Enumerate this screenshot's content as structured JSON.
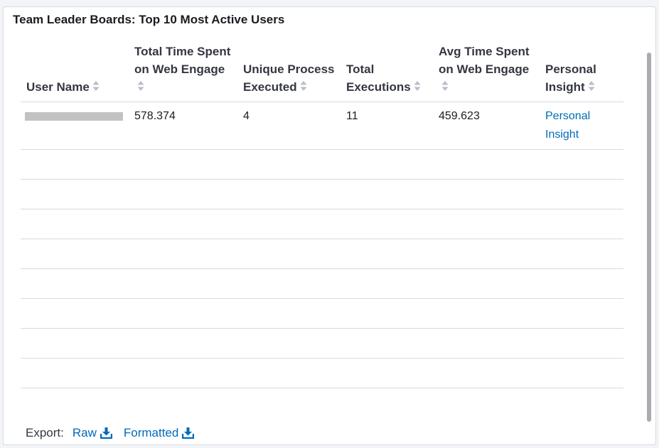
{
  "panel": {
    "title": "Team Leader Boards: Top 10 Most Active Users"
  },
  "table": {
    "columns": [
      {
        "label": "User Name",
        "sortable": true
      },
      {
        "label": "Total Time Spent on Web Engage",
        "sortable": true
      },
      {
        "label": "Unique Process Executed",
        "sortable": true
      },
      {
        "label": "Total Executions",
        "sortable": true
      },
      {
        "label": "Avg Time Spent on Web Engage",
        "sortable": true
      },
      {
        "label": "Personal Insight",
        "sortable": true
      }
    ],
    "rows": [
      {
        "user_name": "",
        "user_name_redacted": true,
        "total_time": "578.374",
        "unique_process": "4",
        "total_executions": "11",
        "avg_time": "459.623",
        "insight_link": "Personal Insight"
      }
    ],
    "empty_rows": 8
  },
  "export": {
    "label": "Export:",
    "raw_label": "Raw",
    "formatted_label": "Formatted"
  },
  "icons": {
    "sort": "sort-icon",
    "download": "download-icon"
  },
  "colors": {
    "link": "#006bb8",
    "text": "#1a1c21",
    "border": "#d3dae6",
    "redaction": "#c2c2c2"
  }
}
